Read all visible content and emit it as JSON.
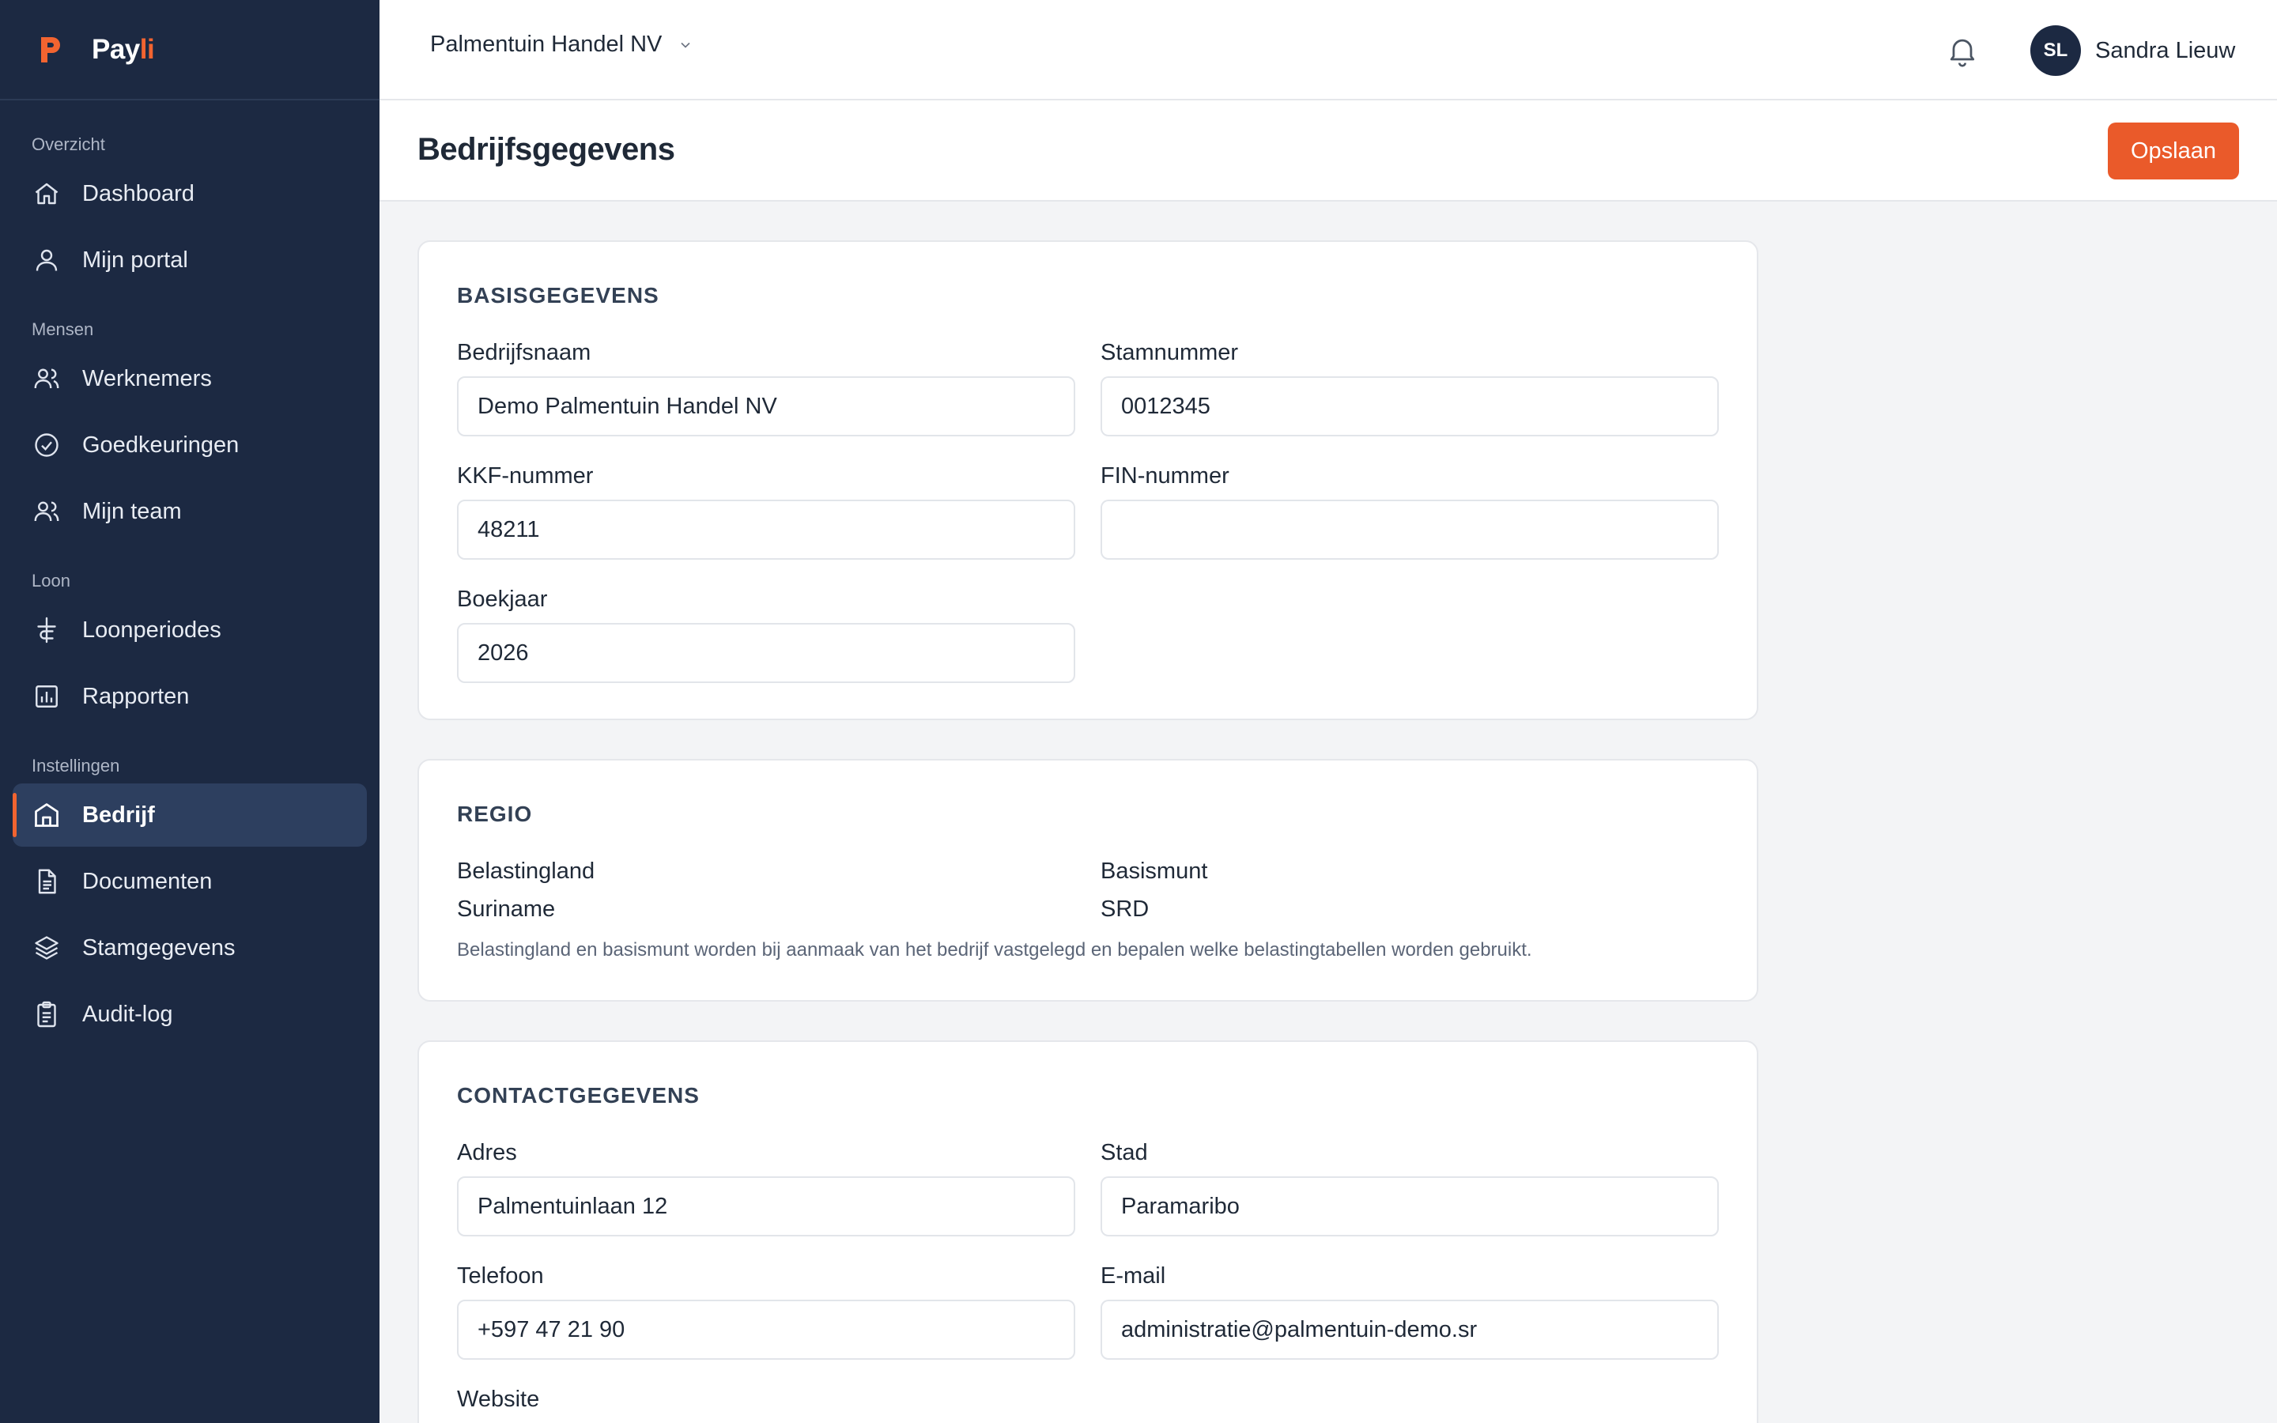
{
  "brand": {
    "name_part1": "Pay",
    "name_part2": "li",
    "accent_color": "#f26430",
    "logo_icon": "payli-p-logo"
  },
  "sidebar": {
    "background": "#1c2942",
    "sections": [
      {
        "label": "Overzicht",
        "items": [
          {
            "label": "Dashboard",
            "icon": "home-icon"
          },
          {
            "label": "Mijn portal",
            "icon": "user-icon"
          }
        ]
      },
      {
        "label": "Mensen",
        "items": [
          {
            "label": "Werknemers",
            "icon": "users-icon"
          },
          {
            "label": "Goedkeuringen",
            "icon": "check-circle-icon"
          },
          {
            "label": "Mijn team",
            "icon": "team-icon"
          }
        ]
      },
      {
        "label": "Loon",
        "items": [
          {
            "label": "Loonperiodes",
            "icon": "currency-icon"
          },
          {
            "label": "Rapporten",
            "icon": "bar-chart-icon"
          }
        ]
      },
      {
        "label": "Instellingen",
        "items": [
          {
            "label": "Bedrijf",
            "icon": "building-icon",
            "active": true
          },
          {
            "label": "Documenten",
            "icon": "document-icon"
          },
          {
            "label": "Stamgegevens",
            "icon": "layers-icon"
          },
          {
            "label": "Audit-log",
            "icon": "clipboard-icon"
          }
        ]
      }
    ]
  },
  "topbar": {
    "company": "Palmentuin Handel NV",
    "user_initials": "SL",
    "user_name": "Sandra Lieuw"
  },
  "page": {
    "title": "Bedrijfsgegevens",
    "save_label": "Opslaan",
    "save_color": "#ea5a2a"
  },
  "basis": {
    "title": "BASISGEGEVENS",
    "bedrijfsnaam_label": "Bedrijfsnaam",
    "bedrijfsnaam_value": "Demo Palmentuin Handel NV",
    "stamnummer_label": "Stamnummer",
    "stamnummer_value": "0012345",
    "kkf_label": "KKF-nummer",
    "kkf_value": "48211",
    "fin_label": "FIN-nummer",
    "fin_value": "",
    "boekjaar_label": "Boekjaar",
    "boekjaar_value": "2026"
  },
  "regio": {
    "title": "REGIO",
    "belastingland_label": "Belastingland",
    "belastingland_value": "Suriname",
    "basismunt_label": "Basismunt",
    "basismunt_value": "SRD",
    "help": "Belastingland en basismunt worden bij aanmaak van het bedrijf vastgelegd en bepalen welke belastingtabellen worden gebruikt."
  },
  "contact": {
    "title": "CONTACTGEGEVENS",
    "adres_label": "Adres",
    "adres_value": "Palmentuinlaan 12",
    "stad_label": "Stad",
    "stad_value": "Paramaribo",
    "telefoon_label": "Telefoon",
    "telefoon_value": "+597 47 21 90",
    "email_label": "E-mail",
    "email_value": "administratie@palmentuin-demo.sr",
    "website_label": "Website"
  }
}
